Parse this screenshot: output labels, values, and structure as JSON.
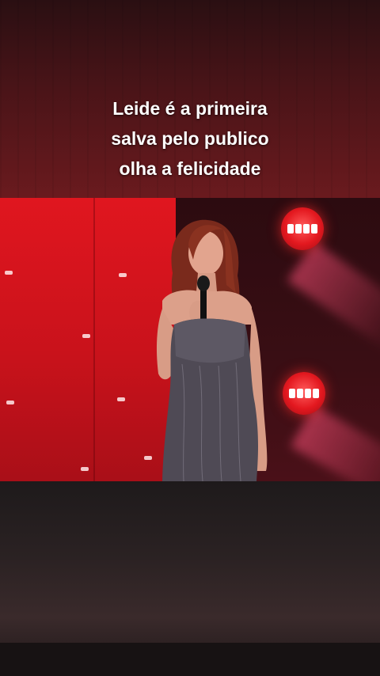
{
  "caption": {
    "line1": "Leide é a primeira",
    "line2": "salva pelo publico",
    "line3": "olha a felicidade"
  },
  "colors": {
    "led_wall": "#d9141c",
    "backdrop": "#3a0e14",
    "caption_text": "#ffffff",
    "bottom_bg": "#2b2223"
  },
  "scene": {
    "subject": "performer-with-microphone",
    "stage_lights": [
      "spotlight-icon",
      "spotlight-icon"
    ]
  }
}
